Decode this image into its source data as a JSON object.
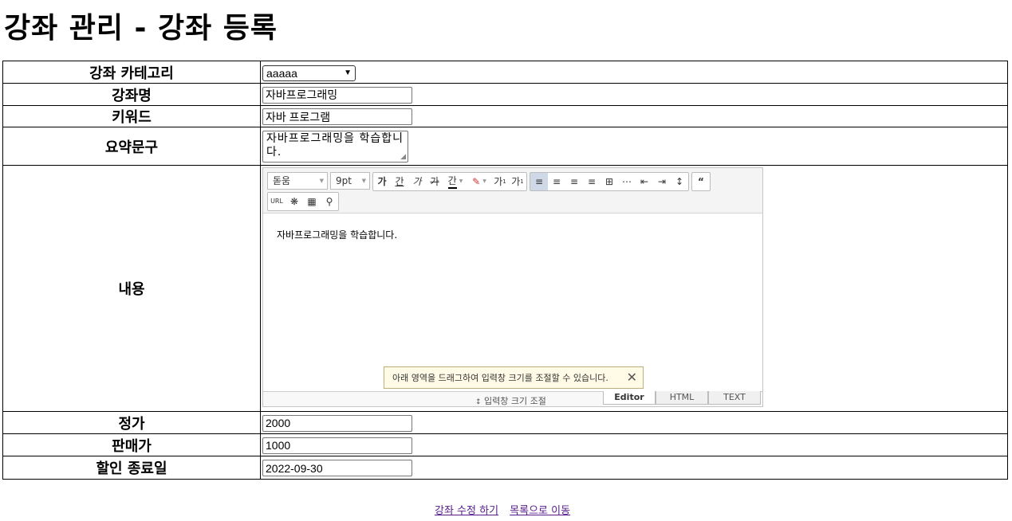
{
  "page": {
    "title": "강좌 관리 - 강좌 등록"
  },
  "form": {
    "category": {
      "label": "강좌 카테고리",
      "value": "aaaaa"
    },
    "name": {
      "label": "강좌명",
      "value": "자바프로그래밍"
    },
    "keyword": {
      "label": "키워드",
      "value": "자바 프로그램"
    },
    "summary": {
      "label": "요약문구",
      "value": "자바프로그래밍을 학습합니다."
    },
    "content": {
      "label": "내용"
    },
    "price": {
      "label": "정가",
      "value": "2000"
    },
    "sale_price": {
      "label": "판매가",
      "value": "1000"
    },
    "sale_end": {
      "label": "할인 종료일",
      "value": "2022-09-30"
    }
  },
  "editor": {
    "font": "돋움",
    "size": "9pt",
    "body_text": "자바프로그래밍을 학습합니다.",
    "tooltip": "아래 영역을 드래그하여 입력창 크기를 조절할 수 있습니다.",
    "resize_label": "입력창 크기 조절",
    "tabs": [
      "Editor",
      "HTML",
      "TEXT"
    ],
    "buttons": {
      "bold": "가",
      "underline": "간",
      "italic": "가",
      "strike": "가",
      "fontcolor": "간",
      "superscript": "가",
      "subscript": "가",
      "url": "URL"
    }
  },
  "actions": {
    "submit": "강좌 수정 하기",
    "list": "목록으로 이동"
  }
}
